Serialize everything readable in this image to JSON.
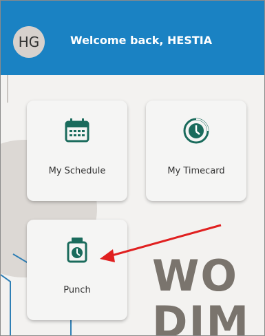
{
  "header": {
    "avatar_initials": "HG",
    "welcome_text": "Welcome back, HESTIA",
    "background_color": "#1a82c3"
  },
  "tiles": [
    {
      "label": "My Schedule",
      "icon": "calendar-icon"
    },
    {
      "label": "My Timecard",
      "icon": "timecard-clock-icon"
    },
    {
      "label": "Punch",
      "icon": "punch-clock-icon"
    }
  ],
  "background_text": {
    "line1": "WO",
    "line2": "DIM"
  },
  "colors": {
    "accent": "#1a6b5c",
    "arrow": "#e02020"
  }
}
